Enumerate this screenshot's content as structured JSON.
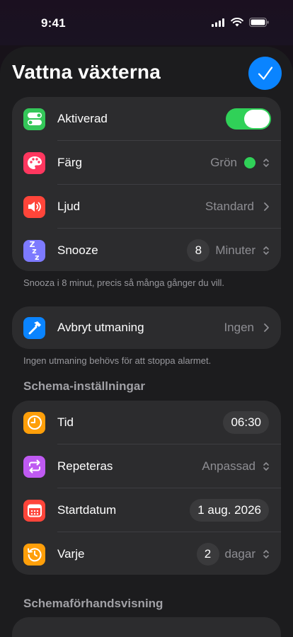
{
  "status": {
    "time": "9:41"
  },
  "title": "Vattna växterna",
  "group1": {
    "enabled": {
      "label": "Aktiverad",
      "on": true
    },
    "color": {
      "label": "Färg",
      "value": "Grön",
      "dot_color": "#30d158"
    },
    "sound": {
      "label": "Ljud",
      "value": "Standard"
    },
    "snooze": {
      "label": "Snooze",
      "count": "8",
      "unit": "Minuter"
    }
  },
  "snooze_note": "Snooza i 8 minut, precis så många gånger du vill.",
  "challenge": {
    "label": "Avbryt utmaning",
    "value": "Ingen"
  },
  "challenge_note": "Ingen utmaning behövs för att stoppa alarmet.",
  "schedule_header": "Schema-inställningar",
  "schedule": {
    "time": {
      "label": "Tid",
      "value": "06:30"
    },
    "repeat": {
      "label": "Repeteras",
      "value": "Anpassad"
    },
    "start": {
      "label": "Startdatum",
      "value": "1 aug. 2026"
    },
    "every": {
      "label": "Varje",
      "count": "2",
      "unit": "dagar"
    }
  },
  "preview_header": "Schemaförhandsvisning",
  "colors": {
    "accent": "#0a84ff",
    "toggle_on": "#30d158",
    "icon_toggle": "#34c759",
    "icon_palette": "#ff375f",
    "icon_sound": "#ff453a",
    "icon_snooze": "#7d7aff",
    "icon_hammer": "#0a84ff",
    "icon_clock": "#ff9f0a",
    "icon_repeat": "#bf5af2",
    "icon_calendar": "#ff453a",
    "icon_history": "#ff9f0a"
  }
}
